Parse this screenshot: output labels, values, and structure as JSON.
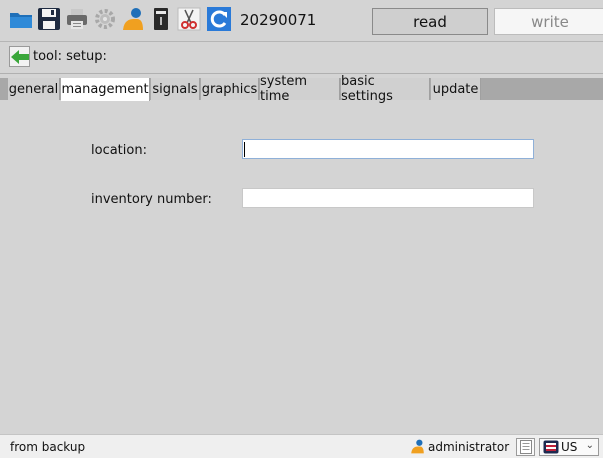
{
  "toolbar": {
    "serial_number": "20290071",
    "read_label": "read",
    "write_label": "write",
    "icons": [
      "open-folder-icon",
      "save-icon",
      "print-icon",
      "settings-gear-icon",
      "user-icon",
      "device-icon",
      "scissors-icon",
      "refresh-icon"
    ]
  },
  "breadcrumb": {
    "text": "tool: setup:"
  },
  "tabs": [
    {
      "label": "general",
      "active": false
    },
    {
      "label": "management",
      "active": true
    },
    {
      "label": "signals",
      "active": false
    },
    {
      "label": "graphics",
      "active": false
    },
    {
      "label": "system time",
      "active": false
    },
    {
      "label": "basic settings",
      "active": false
    },
    {
      "label": "update",
      "active": false
    }
  ],
  "form": {
    "location_label": "location:",
    "location_value": "",
    "inventory_label": "inventory number:",
    "inventory_value": ""
  },
  "statusbar": {
    "source_text": "from backup",
    "user_name": "administrator",
    "language": "US"
  },
  "colors": {
    "background": "#d4d4d4",
    "tab_active": "#ffffff",
    "tab_strip": "#a8a8a8",
    "back_arrow": "#3aa63a",
    "refresh_blue": "#2a7ad8"
  }
}
